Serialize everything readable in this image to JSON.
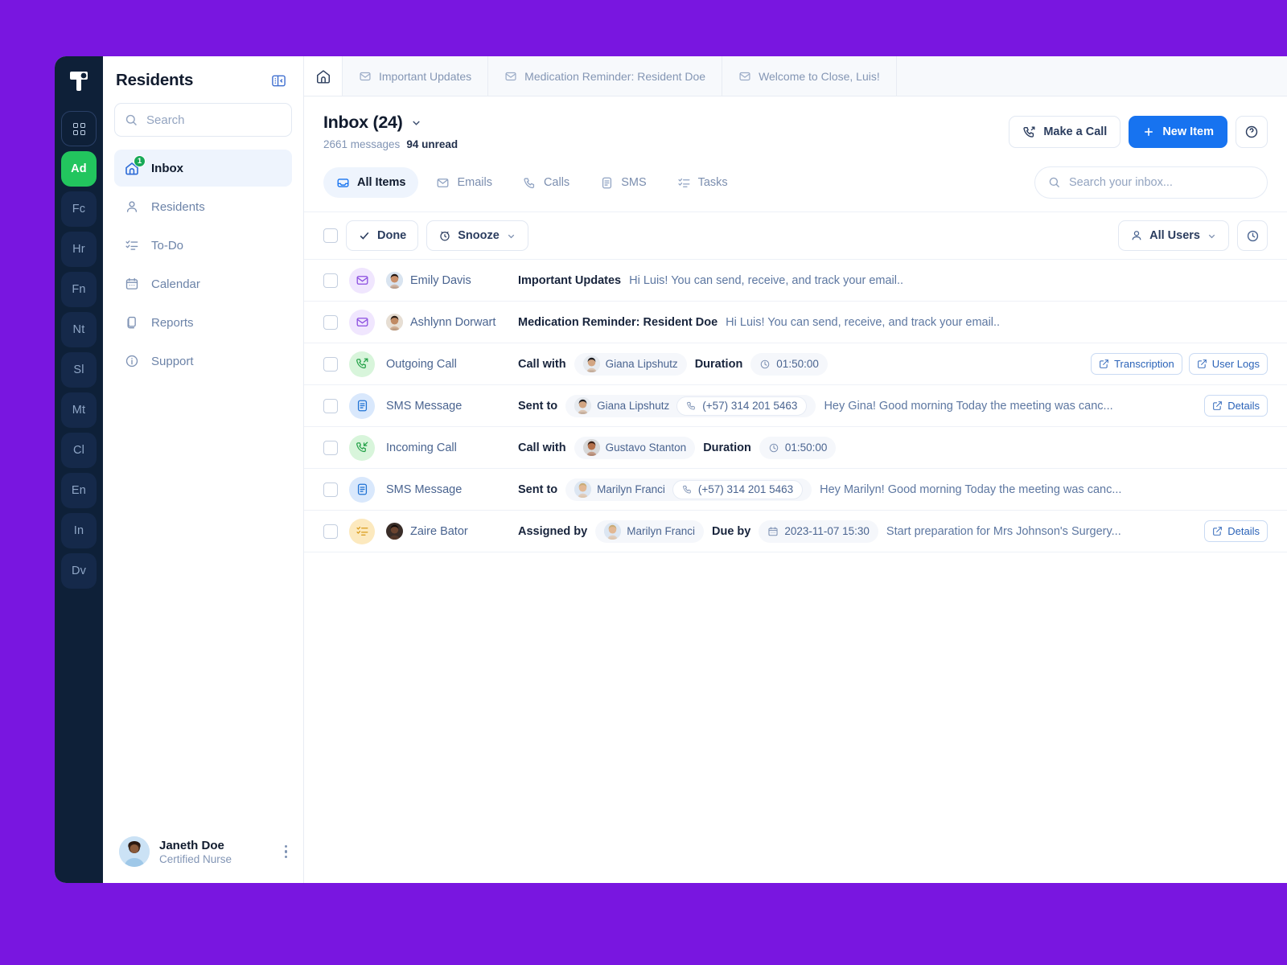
{
  "brand": {
    "accent": "#1773F0",
    "active_green": "#22C55E",
    "page_bg": "#7916E0"
  },
  "rail": {
    "logo_name": "app-logo",
    "items": [
      {
        "label": "",
        "name": "grid-menu",
        "type": "grid"
      },
      {
        "label": "Ad",
        "name": "workspace-ad",
        "active": true
      },
      {
        "label": "Fc",
        "name": "workspace-fc"
      },
      {
        "label": "Hr",
        "name": "workspace-hr"
      },
      {
        "label": "Fn",
        "name": "workspace-fn"
      },
      {
        "label": "Nt",
        "name": "workspace-nt"
      },
      {
        "label": "Sl",
        "name": "workspace-sl"
      },
      {
        "label": "Mt",
        "name": "workspace-mt"
      },
      {
        "label": "Cl",
        "name": "workspace-cl"
      },
      {
        "label": "En",
        "name": "workspace-en"
      },
      {
        "label": "In",
        "name": "workspace-in"
      },
      {
        "label": "Dv",
        "name": "workspace-dv"
      }
    ]
  },
  "sidebar": {
    "title": "Residents",
    "collapse_icon": "panel-collapse-icon",
    "search_placeholder": "Search",
    "nav": [
      {
        "label": "Inbox",
        "icon": "inbox-home-icon",
        "active": true,
        "badge": "1"
      },
      {
        "label": "Residents",
        "icon": "user-icon"
      },
      {
        "label": "To-Do",
        "icon": "checklist-icon"
      },
      {
        "label": "Calendar",
        "icon": "calendar-icon"
      },
      {
        "label": "Reports",
        "icon": "documents-icon"
      },
      {
        "label": "Support",
        "icon": "info-circle-icon"
      }
    ],
    "user": {
      "name": "Janeth Doe",
      "role": "Certified Nurse",
      "menu_icon": "kebab-menu-icon"
    }
  },
  "tabs": {
    "home_icon": "home-icon",
    "items": [
      {
        "label": "Important Updates",
        "icon": "envelope-check-icon"
      },
      {
        "label": "Medication Reminder: Resident Doe",
        "icon": "envelope-check-icon"
      },
      {
        "label": "Welcome to Close, Luis!",
        "icon": "envelope-check-icon"
      }
    ]
  },
  "page": {
    "title": "Inbox (24)",
    "dropdown_icon": "chevron-down-icon",
    "messages_count": "2661 messages",
    "unread_count": "94 unread",
    "make_call_label": "Make a Call",
    "make_call_icon": "phone-outgoing-icon",
    "new_item_label": "New Item",
    "new_item_icon": "plus-icon",
    "more_icon": "more-options-icon"
  },
  "filters": {
    "chips": [
      {
        "label": "All Items",
        "icon": "inbox-tray-icon",
        "active": true
      },
      {
        "label": "Emails",
        "icon": "envelope-icon"
      },
      {
        "label": "Calls",
        "icon": "phone-icon"
      },
      {
        "label": "SMS",
        "icon": "message-icon"
      },
      {
        "label": "Tasks",
        "icon": "checklist-icon"
      }
    ],
    "search_placeholder": "Search your inbox...",
    "search_icon": "search-icon"
  },
  "toolbar": {
    "select_all_name": "select-all-checkbox",
    "done_label": "Done",
    "done_icon": "check-icon",
    "snooze_label": "Snooze",
    "snooze_icon": "alarm-clock-icon",
    "snooze_caret": "chevron-down-icon",
    "all_users_label": "All Users",
    "all_users_icon": "user-icon",
    "all_users_caret": "chevron-down-icon",
    "clock_filter_icon": "clock-icon"
  },
  "rows": [
    {
      "type": "email",
      "icon": "envelope-check-icon",
      "icon_bg": "ic-mail",
      "has_avatar": true,
      "avatar": "emily-davis-avatar",
      "label": "Emily Davis",
      "subject": "Important Updates",
      "snippet": "Hi Luis! You can send, receive, and track your email..",
      "actions": []
    },
    {
      "type": "email",
      "icon": "envelope-check-icon",
      "icon_bg": "ic-mail",
      "has_avatar": true,
      "avatar": "ashlynn-dorwart-avatar",
      "label": "Ashlynn Dorwart",
      "subject": "Medication Reminder: Resident Doe",
      "snippet": "Hi Luis! You can send, receive, and track your email..",
      "actions": []
    },
    {
      "type": "call-outgoing",
      "icon": "phone-outgoing-icon",
      "icon_bg": "ic-call",
      "has_avatar": false,
      "label": "Outgoing Call",
      "field1_label": "Call with",
      "contact": "Giana Lipshutz",
      "contact_avatar": "giana-lipshutz-avatar",
      "field2_label": "Duration",
      "duration": "01:50:00",
      "duration_icon": "clock-icon",
      "actions": [
        {
          "label": "Transcription",
          "icon": "external-link-icon"
        },
        {
          "label": "User Logs",
          "icon": "external-link-icon"
        }
      ]
    },
    {
      "type": "sms",
      "icon": "message-icon",
      "icon_bg": "ic-sms",
      "has_avatar": false,
      "label": "SMS Message",
      "field1_label": "Sent to",
      "contact": "Giana Lipshutz",
      "contact_avatar": "giana-lipshutz-avatar",
      "phone": "(+57) 314 201 5463",
      "phone_icon": "phone-icon",
      "snippet": "Hey Gina! Good morning Today the meeting was canc...",
      "actions": [
        {
          "label": "Details",
          "icon": "external-link-icon"
        }
      ]
    },
    {
      "type": "call-incoming",
      "icon": "phone-incoming-icon",
      "icon_bg": "ic-call",
      "has_avatar": false,
      "label": "Incoming Call",
      "field1_label": "Call with",
      "contact": "Gustavo Stanton",
      "contact_avatar": "gustavo-stanton-avatar",
      "field2_label": "Duration",
      "duration": "01:50:00",
      "duration_icon": "clock-icon",
      "actions": []
    },
    {
      "type": "sms",
      "icon": "message-icon",
      "icon_bg": "ic-sms",
      "has_avatar": false,
      "label": "SMS Message",
      "field1_label": "Sent to",
      "contact": "Marilyn Franci",
      "contact_avatar": "marilyn-franci-avatar",
      "phone": "(+57) 314 201 5463",
      "phone_icon": "phone-icon",
      "snippet": "Hey Marilyn! Good morning Today the meeting was canc...",
      "actions": []
    },
    {
      "type": "task",
      "icon": "checklist-icon",
      "icon_bg": "ic-task",
      "has_avatar": true,
      "avatar": "zaire-bator-avatar",
      "label": "Zaire Bator",
      "field1_label": "Assigned by",
      "contact": "Marilyn Franci",
      "contact_avatar": "marilyn-franci-avatar",
      "field2_label": "Due by",
      "due": "2023-11-07 15:30",
      "due_icon": "calendar-icon",
      "snippet": "Start preparation for Mrs Johnson's Surgery...",
      "actions": [
        {
          "label": "Details",
          "icon": "external-link-icon"
        }
      ]
    }
  ]
}
